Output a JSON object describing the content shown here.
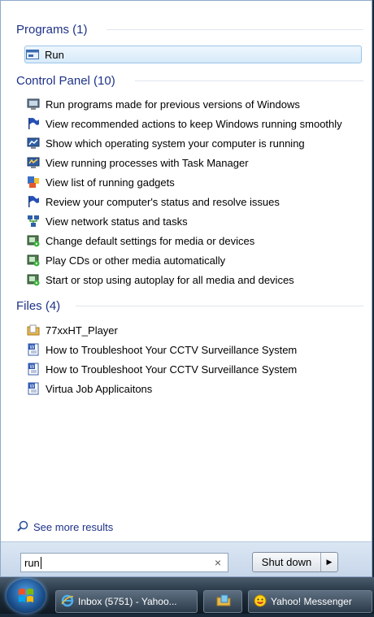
{
  "groups": [
    {
      "title": "Programs (1)",
      "items": [
        {
          "label": "Run",
          "icon": "run-icon"
        }
      ]
    },
    {
      "title": "Control Panel (10)",
      "items": [
        {
          "label": "Run programs made for previous versions of Windows",
          "icon": "compatibility-icon"
        },
        {
          "label": "View recommended actions to keep Windows running smoothly",
          "icon": "action-center-flag-icon"
        },
        {
          "label": "Show which operating system your computer is running",
          "icon": "system-icon"
        },
        {
          "label": "View running processes with Task Manager",
          "icon": "task-manager-icon"
        },
        {
          "label": "View list of running gadgets",
          "icon": "gadgets-icon"
        },
        {
          "label": "Review your computer's status and resolve issues",
          "icon": "action-center-flag-icon"
        },
        {
          "label": "View network status and tasks",
          "icon": "network-icon"
        },
        {
          "label": "Change default settings for media or devices",
          "icon": "autoplay-icon"
        },
        {
          "label": "Play CDs or other media automatically",
          "icon": "autoplay-icon"
        },
        {
          "label": "Start or stop using autoplay for all media and devices",
          "icon": "autoplay-icon"
        }
      ]
    },
    {
      "title": "Files (4)",
      "items": [
        {
          "label": "77xxHT_Player",
          "icon": "folder-icon"
        },
        {
          "label": "How to Troubleshoot Your CCTV Surveillance System",
          "icon": "word-document-icon"
        },
        {
          "label": "How to Troubleshoot Your CCTV Surveillance System",
          "icon": "word-document-icon"
        },
        {
          "label": "Virtua Job Applicaitons",
          "icon": "word-document-icon"
        }
      ]
    }
  ],
  "see_more": "See more results",
  "search": {
    "value": "run",
    "clear": "×"
  },
  "shutdown": {
    "label": "Shut down",
    "arrow": "▶"
  },
  "taskbar": {
    "tasks": [
      {
        "label": "Inbox (5751) - Yahoo...",
        "icon": "ie-icon"
      },
      {
        "label": "",
        "icon": "explorer-icon"
      },
      {
        "label": "Yahoo! Messenger",
        "icon": "yahoo-messenger-icon"
      }
    ]
  },
  "colors": {
    "header": "#1e3287",
    "selection": "#d7eaf9",
    "accent": "#1e3287"
  }
}
